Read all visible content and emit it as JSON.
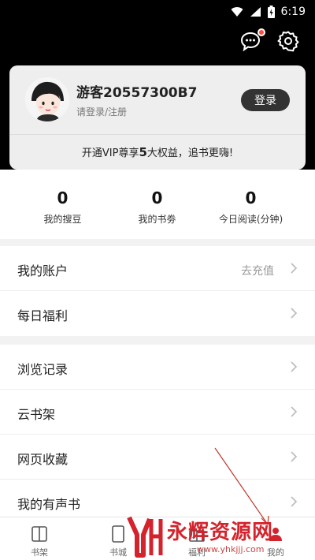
{
  "status_bar": {
    "time": "6:19"
  },
  "profile": {
    "username": "游客20557300B7",
    "subtitle": "请登录/注册",
    "login_label": "登录",
    "vip_prefix": "开通VIP尊享",
    "vip_count": "5",
    "vip_suffix": "大权益，追书更嗨!"
  },
  "stats": [
    {
      "value": "0",
      "label": "我的搜豆"
    },
    {
      "value": "0",
      "label": "我的书劵"
    },
    {
      "value": "0",
      "label": "今日阅读(分钟)"
    }
  ],
  "menu_group_1": [
    {
      "label": "我的账户",
      "value": "去充值"
    },
    {
      "label": "每日福利"
    }
  ],
  "menu_group_2": [
    {
      "label": "浏览记录"
    },
    {
      "label": "云书架"
    },
    {
      "label": "网页收藏"
    },
    {
      "label": "我的有声书"
    }
  ],
  "tabbar": [
    {
      "label": "书架",
      "icon": "bookshelf-icon"
    },
    {
      "label": "书城",
      "icon": "bookstore-icon"
    },
    {
      "label": "福利",
      "icon": "welfare-icon"
    },
    {
      "label": "我的",
      "icon": "profile-icon"
    }
  ],
  "watermark": {
    "text": "永辉资源网",
    "url": "www.yhkjjj.com"
  },
  "colors": {
    "header_bg": "#000000",
    "accent_red": "#d4232c",
    "login_btn": "#333333"
  }
}
